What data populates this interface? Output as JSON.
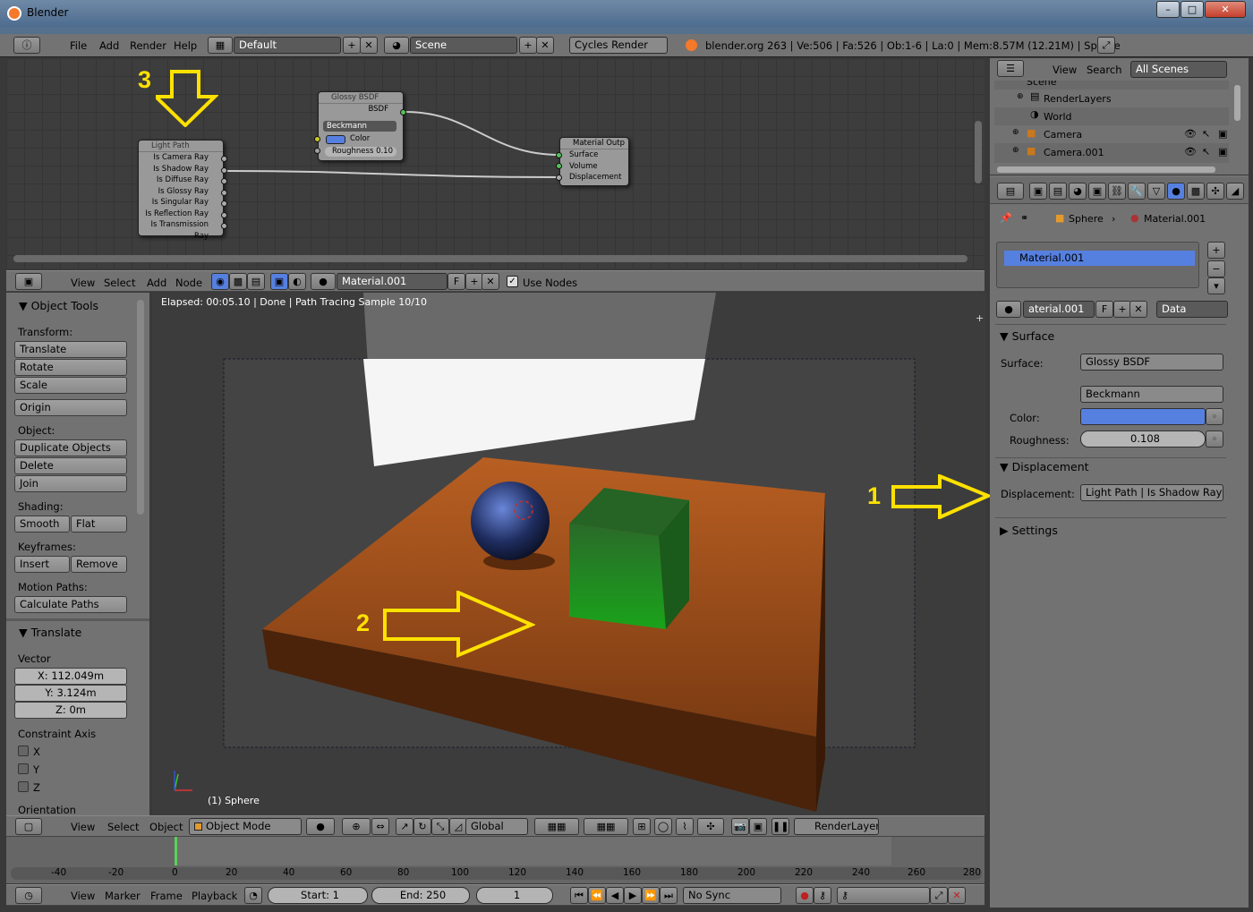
{
  "window": {
    "title": "Blender",
    "controls": [
      "–",
      "□",
      "✕"
    ]
  },
  "info_header": {
    "menus": [
      "File",
      "Add",
      "Render",
      "Help"
    ],
    "screen_layout": "Default",
    "scene": "Scene",
    "render_engine": "Cycles Render",
    "stats": "blender.org 263 | Ve:506 | Fa:526 | Ob:1-6 | La:0 | Mem:8.57M (12.21M) | Sphere"
  },
  "node_editor": {
    "nodes": {
      "glossy": {
        "title": "Glossy BSDF",
        "output": "BSDF",
        "distribution": "Beckmann",
        "color_label": "Color",
        "roughness": "Roughness 0.10"
      },
      "lightpath": {
        "title": "Light Path",
        "outputs": [
          "Is Camera Ray",
          "Is Shadow Ray",
          "Is Diffuse Ray",
          "Is Glossy Ray",
          "Is Singular Ray",
          "Is Reflection Ray",
          "Is Transmission Ray"
        ]
      },
      "matout": {
        "title": "Material Outp",
        "inputs": [
          "Surface",
          "Volume",
          "Displacement"
        ]
      }
    },
    "header": {
      "menus": [
        "View",
        "Select",
        "Add",
        "Node"
      ],
      "material": "Material.001",
      "fake_user": "F",
      "use_nodes_label": "Use Nodes"
    }
  },
  "tool_shelf": {
    "title": "Object Tools",
    "transform_label": "Transform:",
    "translate": "Translate",
    "rotate": "Rotate",
    "scale": "Scale",
    "origin": "Origin",
    "object_label": "Object:",
    "duplicate": "Duplicate Objects",
    "delete": "Delete",
    "join": "Join",
    "shading_label": "Shading:",
    "smooth": "Smooth",
    "flat": "Flat",
    "keyframes_label": "Keyframes:",
    "insert": "Insert",
    "remove": "Remove",
    "motion_paths_label": "Motion Paths:",
    "calculate_paths": "Calculate Paths",
    "operator_title": "Translate",
    "vector_label": "Vector",
    "x": "X: 112.049m",
    "y": "Y: 3.124m",
    "z": "Z: 0m",
    "constraint_label": "Constraint Axis",
    "axes": [
      "X",
      "Y",
      "Z"
    ],
    "orientation_label": "Orientation"
  },
  "viewport": {
    "status": "Elapsed: 00:05.10 | Done | Path Tracing Sample 10/10",
    "object_label": "(1) Sphere",
    "header": {
      "menus": [
        "View",
        "Select",
        "Object"
      ],
      "mode": "Object Mode",
      "orientation": "Global",
      "render_layer": "RenderLayer"
    }
  },
  "annotations": {
    "one": "1",
    "two": "2",
    "three": "3",
    "arrow_color": "#ffe100"
  },
  "outliner": {
    "menus": [
      "View",
      "Search"
    ],
    "filter": "All Scenes",
    "items": [
      "Scene",
      "RenderLayers",
      "World",
      "Camera",
      "Camera.001"
    ]
  },
  "properties": {
    "breadcrumb": [
      "Sphere",
      "Material.001"
    ],
    "slot": "Material.001",
    "material_field": "aterial.001",
    "fake_user": "F",
    "link": "Data",
    "surface_section": "Surface",
    "surface_label": "Surface:",
    "surface_value": "Glossy BSDF",
    "distribution": "Beckmann",
    "color_label": "Color:",
    "color_value": "#5680e0",
    "roughness_label": "Roughness:",
    "roughness_value": "0.108",
    "displacement_section": "Displacement",
    "displacement_label": "Displacement:",
    "displacement_value": "Light Path | Is Shadow Ray",
    "settings_section": "Settings"
  },
  "timeline": {
    "ticks": [
      "-40",
      "-20",
      "0",
      "20",
      "40",
      "60",
      "80",
      "100",
      "120",
      "140",
      "160",
      "180",
      "200",
      "220",
      "240",
      "260",
      "280"
    ],
    "menus": [
      "View",
      "Marker",
      "Frame",
      "Playback"
    ],
    "start": "Start: 1",
    "end": "End: 250",
    "current": "1",
    "sync": "No Sync"
  }
}
